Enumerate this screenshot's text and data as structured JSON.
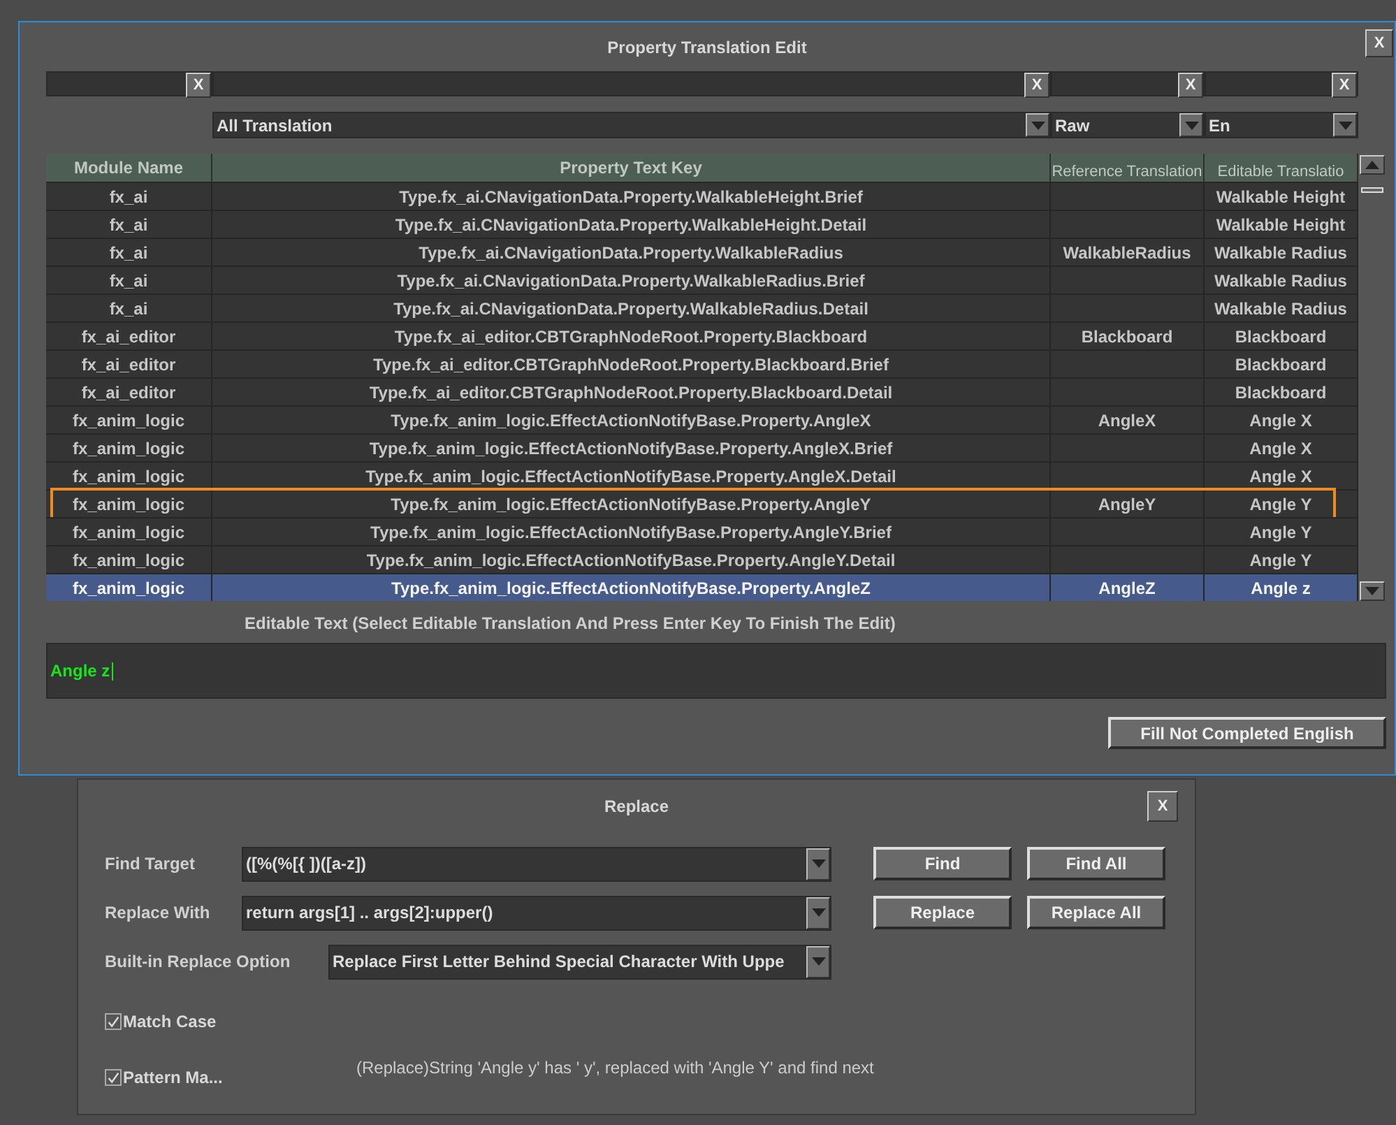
{
  "dialog": {
    "title": "Property Translation Edit",
    "close": "X"
  },
  "filters": [
    {
      "clear": "X"
    },
    {
      "clear": "X"
    },
    {
      "clear": "X"
    },
    {
      "clear": "X"
    }
  ],
  "dropdowns": [
    {
      "value": "All Translation"
    },
    {
      "value": "Raw"
    },
    {
      "value": "En"
    }
  ],
  "table": {
    "columns": [
      "Module Name",
      "Property Text Key",
      "Reference Translation",
      "Editable Translatio"
    ],
    "rows": [
      {
        "module": "fx_ai",
        "key": "Type.fx_ai.CNavigationData.Property.WalkableHeight.Brief",
        "reference": "",
        "editable": "Walkable Height",
        "selected": false,
        "highlighted": false
      },
      {
        "module": "fx_ai",
        "key": "Type.fx_ai.CNavigationData.Property.WalkableHeight.Detail",
        "reference": "",
        "editable": "Walkable Height",
        "selected": false,
        "highlighted": false
      },
      {
        "module": "fx_ai",
        "key": "Type.fx_ai.CNavigationData.Property.WalkableRadius",
        "reference": "WalkableRadius",
        "editable": "Walkable Radius",
        "selected": false,
        "highlighted": false
      },
      {
        "module": "fx_ai",
        "key": "Type.fx_ai.CNavigationData.Property.WalkableRadius.Brief",
        "reference": "",
        "editable": "Walkable Radius",
        "selected": false,
        "highlighted": false
      },
      {
        "module": "fx_ai",
        "key": "Type.fx_ai.CNavigationData.Property.WalkableRadius.Detail",
        "reference": "",
        "editable": "Walkable Radius",
        "selected": false,
        "highlighted": false
      },
      {
        "module": "fx_ai_editor",
        "key": "Type.fx_ai_editor.CBTGraphNodeRoot.Property.Blackboard",
        "reference": "Blackboard",
        "editable": "Blackboard",
        "selected": false,
        "highlighted": false
      },
      {
        "module": "fx_ai_editor",
        "key": "Type.fx_ai_editor.CBTGraphNodeRoot.Property.Blackboard.Brief",
        "reference": "",
        "editable": "Blackboard",
        "selected": false,
        "highlighted": false
      },
      {
        "module": "fx_ai_editor",
        "key": "Type.fx_ai_editor.CBTGraphNodeRoot.Property.Blackboard.Detail",
        "reference": "",
        "editable": "Blackboard",
        "selected": false,
        "highlighted": false
      },
      {
        "module": "fx_anim_logic",
        "key": "Type.fx_anim_logic.EffectActionNotifyBase.Property.AngleX",
        "reference": "AngleX",
        "editable": "Angle X",
        "selected": false,
        "highlighted": false
      },
      {
        "module": "fx_anim_logic",
        "key": "Type.fx_anim_logic.EffectActionNotifyBase.Property.AngleX.Brief",
        "reference": "",
        "editable": "Angle X",
        "selected": false,
        "highlighted": false
      },
      {
        "module": "fx_anim_logic",
        "key": "Type.fx_anim_logic.EffectActionNotifyBase.Property.AngleX.Detail",
        "reference": "",
        "editable": "Angle X",
        "selected": false,
        "highlighted": false
      },
      {
        "module": "fx_anim_logic",
        "key": "Type.fx_anim_logic.EffectActionNotifyBase.Property.AngleY",
        "reference": "AngleY",
        "editable": "Angle Y",
        "selected": false,
        "highlighted": true
      },
      {
        "module": "fx_anim_logic",
        "key": "Type.fx_anim_logic.EffectActionNotifyBase.Property.AngleY.Brief",
        "reference": "",
        "editable": "Angle Y",
        "selected": false,
        "highlighted": false
      },
      {
        "module": "fx_anim_logic",
        "key": "Type.fx_anim_logic.EffectActionNotifyBase.Property.AngleY.Detail",
        "reference": "",
        "editable": "Angle Y",
        "selected": false,
        "highlighted": false
      },
      {
        "module": "fx_anim_logic",
        "key": "Type.fx_anim_logic.EffectActionNotifyBase.Property.AngleZ",
        "reference": "AngleZ",
        "editable": "Angle z",
        "selected": true,
        "highlighted": false
      }
    ]
  },
  "editor": {
    "label": "Editable Text (Select Editable Translation And Press Enter Key To Finish The Edit)",
    "value": "Angle z"
  },
  "fill_button": "Fill Not Completed English",
  "replace": {
    "title": "Replace",
    "close": "X",
    "fields": [
      {
        "label": "Find Target",
        "value": "([%(%[{ ])([a-z])"
      },
      {
        "label": "Replace With",
        "value": "return args[1] .. args[2]:upper()"
      }
    ],
    "buttons": [
      [
        "Find",
        "Find All"
      ],
      [
        "Replace",
        "Replace All"
      ]
    ],
    "option": {
      "label": "Built-in Replace Option",
      "value": "Replace First Letter Behind Special Character With Uppe"
    },
    "checkboxes": [
      {
        "label": "Match Case",
        "checked": true
      },
      {
        "label": "Pattern Ma...",
        "checked": true
      }
    ],
    "status": "(Replace)String 'Angle y' has ' y', replaced with 'Angle Y' and find next"
  }
}
